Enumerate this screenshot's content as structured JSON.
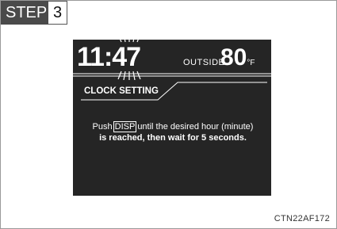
{
  "step": {
    "label": "STEP",
    "number": "3"
  },
  "display": {
    "time_hours": "11:",
    "time_minutes": "47",
    "outside_label": "OUTSIDE",
    "temperature": "80",
    "temperature_unit": "°F",
    "mode_title": "CLOCK SETTING",
    "instruction": {
      "before": "Push",
      "button": "DISP",
      "after": "until the desired hour (minute)",
      "line2": "is reached, then wait for 5 seconds."
    }
  },
  "reference_code": "CTN22AF172"
}
